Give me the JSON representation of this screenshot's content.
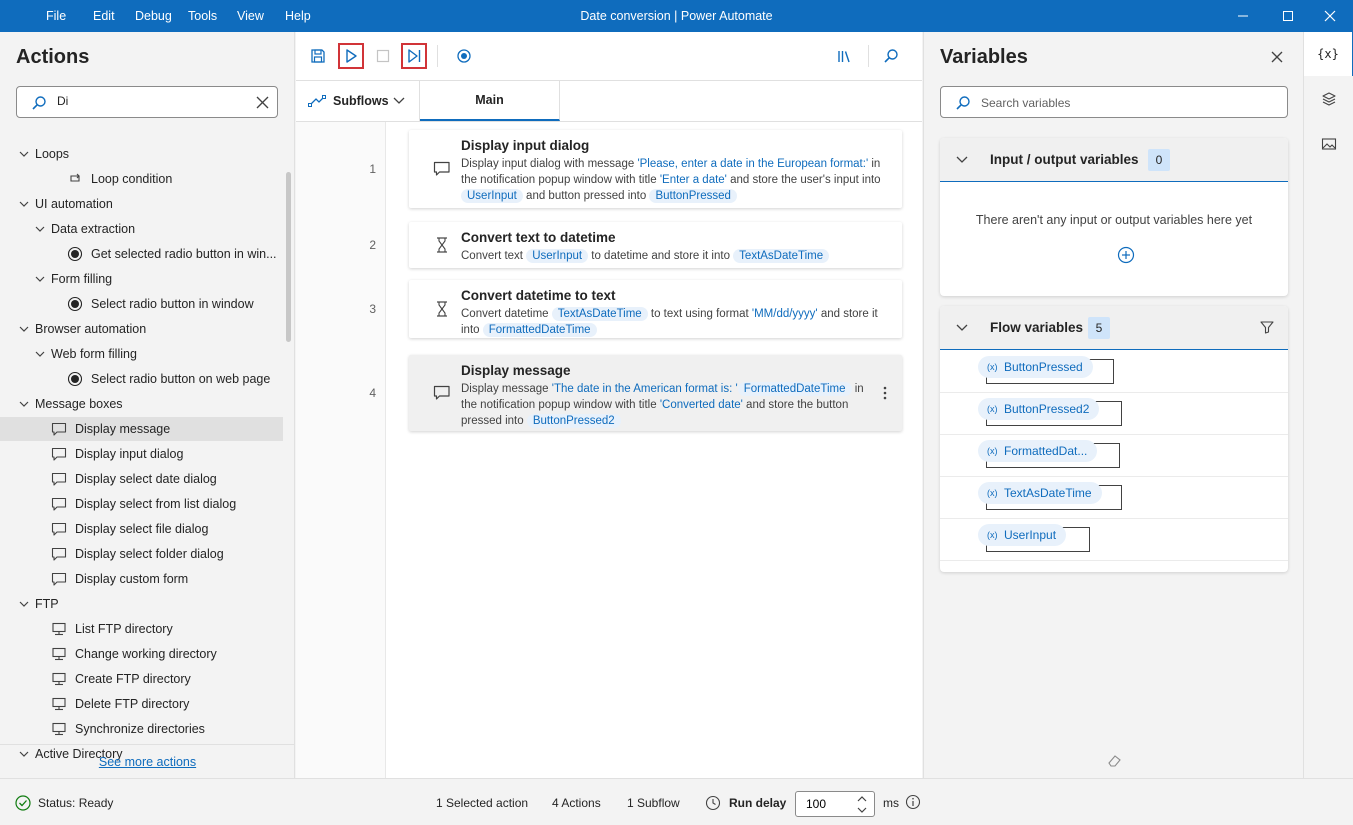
{
  "window": {
    "title": "Date conversion | Power Automate",
    "menu": [
      "File",
      "Edit",
      "Debug",
      "Tools",
      "View",
      "Help"
    ]
  },
  "actions_panel": {
    "title": "Actions",
    "search_value": "Di",
    "tree": [
      {
        "label": "Loops",
        "level": 0,
        "type": "group"
      },
      {
        "label": "Loop condition",
        "level": 2,
        "type": "item",
        "icon": "loop-icon"
      },
      {
        "label": "UI automation",
        "level": 0,
        "type": "group"
      },
      {
        "label": "Data extraction",
        "level": 1,
        "type": "group"
      },
      {
        "label": "Get selected radio button in win...",
        "level": 2,
        "type": "item",
        "icon": "radio-icon"
      },
      {
        "label": "Form filling",
        "level": 1,
        "type": "group"
      },
      {
        "label": "Select radio button in window",
        "level": 2,
        "type": "item",
        "icon": "radio-icon"
      },
      {
        "label": "Browser automation",
        "level": 0,
        "type": "group"
      },
      {
        "label": "Web form filling",
        "level": 1,
        "type": "group"
      },
      {
        "label": "Select radio button on web page",
        "level": 2,
        "type": "item",
        "icon": "radio-icon"
      },
      {
        "label": "Message boxes",
        "level": 0,
        "type": "group"
      },
      {
        "label": "Display message",
        "level": 1,
        "type": "item",
        "icon": "message-icon",
        "selected": true
      },
      {
        "label": "Display input dialog",
        "level": 1,
        "type": "item",
        "icon": "message-icon"
      },
      {
        "label": "Display select date dialog",
        "level": 1,
        "type": "item",
        "icon": "message-icon"
      },
      {
        "label": "Display select from list dialog",
        "level": 1,
        "type": "item",
        "icon": "message-icon"
      },
      {
        "label": "Display select file dialog",
        "level": 1,
        "type": "item",
        "icon": "message-icon"
      },
      {
        "label": "Display select folder dialog",
        "level": 1,
        "type": "item",
        "icon": "message-icon"
      },
      {
        "label": "Display custom form",
        "level": 1,
        "type": "item",
        "icon": "message-icon"
      },
      {
        "label": "FTP",
        "level": 0,
        "type": "group"
      },
      {
        "label": "List FTP directory",
        "level": 1,
        "type": "item",
        "icon": "monitor-icon"
      },
      {
        "label": "Change working directory",
        "level": 1,
        "type": "item",
        "icon": "monitor-icon"
      },
      {
        "label": "Create FTP directory",
        "level": 1,
        "type": "item",
        "icon": "monitor-icon"
      },
      {
        "label": "Delete FTP directory",
        "level": 1,
        "type": "item",
        "icon": "monitor-icon"
      },
      {
        "label": "Synchronize directories",
        "level": 1,
        "type": "item",
        "icon": "monitor-icon"
      },
      {
        "label": "Active Directory",
        "level": 0,
        "type": "group"
      }
    ],
    "see_more": "See more actions"
  },
  "editor": {
    "subflows_label": "Subflows",
    "main_tab": "Main",
    "actions": [
      {
        "num": "1",
        "title": "Display input dialog",
        "icon": "message-icon",
        "parts": [
          {
            "t": "Display input dialog with message "
          },
          {
            "t": "'Please, enter a date in the European format:'",
            "k": "lit"
          },
          {
            "t": " in the notification popup window with title "
          },
          {
            "t": "'Enter a date'",
            "k": "lit"
          },
          {
            "t": " and store the user's input into "
          },
          {
            "t": "UserInput",
            "k": "var"
          },
          {
            "t": " and button pressed into "
          },
          {
            "t": "ButtonPressed",
            "k": "var"
          }
        ]
      },
      {
        "num": "2",
        "title": "Convert text to datetime",
        "icon": "hourglass-icon",
        "parts": [
          {
            "t": "Convert text "
          },
          {
            "t": "UserInput",
            "k": "var"
          },
          {
            "t": " to datetime and store it into "
          },
          {
            "t": "TextAsDateTime",
            "k": "var"
          }
        ]
      },
      {
        "num": "3",
        "title": "Convert datetime to text",
        "icon": "hourglass-icon",
        "parts": [
          {
            "t": "Convert datetime "
          },
          {
            "t": "TextAsDateTime",
            "k": "var"
          },
          {
            "t": " to text using format "
          },
          {
            "t": "'MM/dd/yyyy'",
            "k": "lit"
          },
          {
            "t": " and store it into "
          },
          {
            "t": "FormattedDateTime",
            "k": "var"
          }
        ]
      },
      {
        "num": "4",
        "title": "Display message",
        "icon": "message-icon",
        "selected": true,
        "parts": [
          {
            "t": "Display message "
          },
          {
            "t": "'The date in the American format is: '",
            "k": "lit"
          },
          {
            "t": "FormattedDateTime",
            "k": "var"
          },
          {
            "t": " in the notification popup window with title "
          },
          {
            "t": "'Converted date'",
            "k": "lit"
          },
          {
            "t": " and store the button pressed into "
          },
          {
            "t": "ButtonPressed2",
            "k": "var"
          }
        ]
      }
    ]
  },
  "variables_panel": {
    "title": "Variables",
    "search_placeholder": "Search variables",
    "io_section": {
      "title": "Input / output variables",
      "count": "0",
      "empty_message": "There aren't any input or output variables here yet"
    },
    "flow_section": {
      "title": "Flow variables",
      "count": "5",
      "variables": [
        "ButtonPressed",
        "ButtonPressed2",
        "FormattedDat...",
        "TextAsDateTime",
        "UserInput"
      ]
    }
  },
  "statusbar": {
    "status": "Status: Ready",
    "selected": "1 Selected action",
    "actions_count": "4 Actions",
    "subflows_count": "1 Subflow",
    "run_delay_label": "Run delay",
    "run_delay_value": "100",
    "unit": "ms"
  },
  "colors": {
    "accent": "#0f6cbd",
    "highlight_border": "#d13438"
  }
}
